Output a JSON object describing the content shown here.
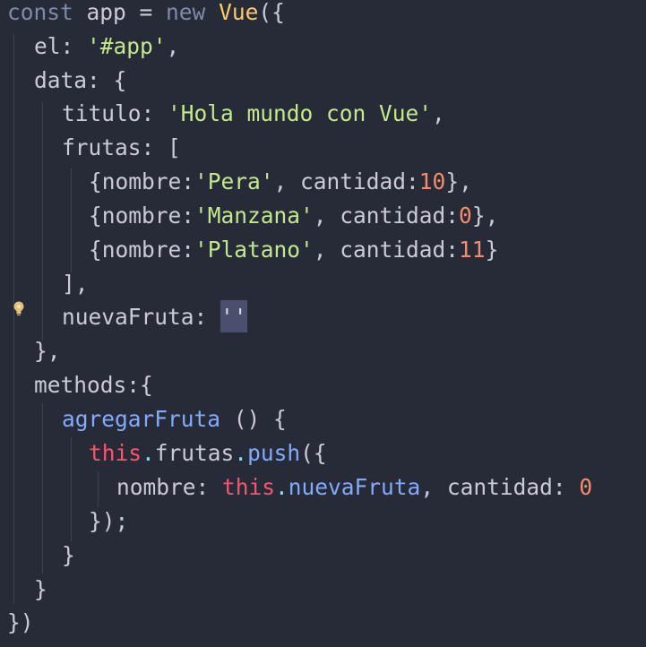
{
  "lines": {
    "l1": {
      "a": "const",
      "b": " app = ",
      "c": "new",
      "d": " ",
      "e": "Vue",
      "f": "({"
    },
    "l2": {
      "a": "el: ",
      "b": "'#app'",
      "c": ","
    },
    "l3": {
      "a": "data: {"
    },
    "l4": {
      "a": "titulo: ",
      "b": "'Hola mundo con Vue'",
      "c": ","
    },
    "l5": {
      "a": "frutas: ["
    },
    "l6": {
      "a": "{nombre:",
      "b": "'Pera'",
      "c": ", cantidad:",
      "d": "10",
      "e": "},"
    },
    "l7": {
      "a": "{nombre:",
      "b": "'Manzana'",
      "c": ", cantidad:",
      "d": "0",
      "e": "},"
    },
    "l8": {
      "a": "{nombre:",
      "b": "'Platano'",
      "c": ", cantidad:",
      "d": "11",
      "e": "}"
    },
    "l9": {
      "a": "],"
    },
    "l10": {
      "a": "nuevaFruta: ",
      "b": "''"
    },
    "l11": {
      "a": "},"
    },
    "l12": {
      "a": "methods:{"
    },
    "l13": {
      "a": "agregarFruta",
      "b": " () {"
    },
    "l14": {
      "a": "this",
      "b": ".",
      "c": "frutas",
      "d": ".",
      "e": "push",
      "f": "({"
    },
    "l15": {
      "a": "nombre: ",
      "b": "this",
      "c": ".",
      "d": "nuevaFruta",
      "e": ", cantidad: ",
      "f": "0"
    },
    "l16": {
      "a": "});"
    },
    "l17": {
      "a": "}"
    },
    "l18": {
      "a": "}"
    },
    "l19": {
      "a": "})"
    }
  },
  "colors": {
    "background": "#272b37",
    "string": "#c3e88d",
    "number": "#f78c6c",
    "keyword": "#7f8aa8",
    "this": "#ff5370",
    "function": "#82aaff",
    "class": "#ffcb6b"
  },
  "icons": {
    "gutter": "lightbulb-icon"
  }
}
